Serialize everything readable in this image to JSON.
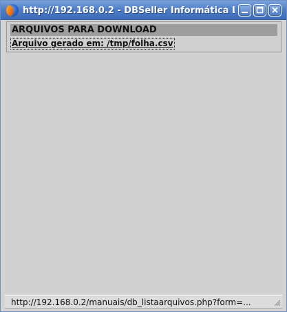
{
  "window": {
    "title": "http://192.168.0.2 - DBSeller Informática L"
  },
  "icons": {
    "app": "firefox-icon",
    "minimize": "minimize-icon",
    "maximize": "maximize-icon",
    "close": "close-icon"
  },
  "colors": {
    "titlebar": "#4f7fc8",
    "header_bg": "#9d9d9d",
    "page_bg": "#d0d0d0"
  },
  "content": {
    "header": "ARQUIVOS PARA DOWNLOAD",
    "file_link": "Arquivo gerado em: /tmp/folha.csv"
  },
  "statusbar": {
    "url": "http://192.168.0.2/manuais/db_listaarquivos.php?form=..."
  }
}
